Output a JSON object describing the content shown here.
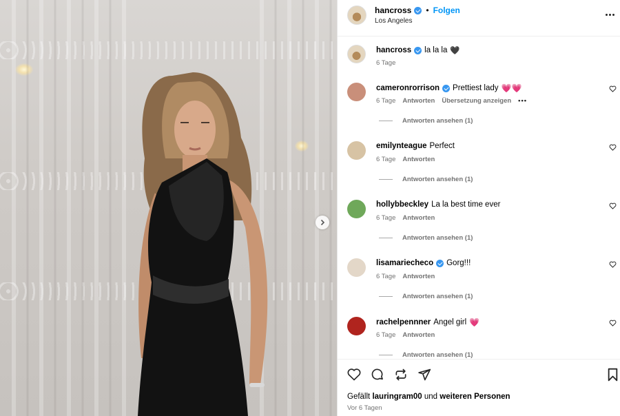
{
  "post": {
    "username": "hancross",
    "follow_label": "Folgen",
    "location": "Los Angeles",
    "caption_text": "la la la",
    "caption_emoji": "🖤",
    "caption_time": "6 Tage"
  },
  "comments": [
    {
      "username": "cameronrorrison",
      "verified": true,
      "text": "Prettiest lady",
      "emoji": "💗💗",
      "time": "6 Tage",
      "reply_label": "Antworten",
      "translate_label": "Übersetzung anzeigen",
      "view_replies": "Antworten ansehen (1)",
      "avatar_color": "#c98f7a"
    },
    {
      "username": "emilynteague",
      "verified": false,
      "text": "Perfect",
      "emoji": "",
      "time": "6 Tage",
      "reply_label": "Antworten",
      "view_replies": "Antworten ansehen (1)",
      "avatar_color": "#d7c3a4"
    },
    {
      "username": "hollybbeckley",
      "verified": false,
      "text": "La la best time ever",
      "emoji": "",
      "time": "6 Tage",
      "reply_label": "Antworten",
      "view_replies": "Antworten ansehen (1)",
      "avatar_color": "#6fa85a"
    },
    {
      "username": "lisamariecheco",
      "verified": true,
      "text": "Gorg!!!",
      "emoji": "",
      "time": "6 Tage",
      "reply_label": "Antworten",
      "view_replies": "Antworten ansehen (1)",
      "avatar_color": "#e3d7c8"
    },
    {
      "username": "rachelpennner",
      "verified": false,
      "text": "Angel girl",
      "emoji": "💗",
      "time": "6 Tage",
      "reply_label": "Antworten",
      "view_replies": "Antworten ansehen (1)",
      "avatar_color": "#b0241e"
    }
  ],
  "footer": {
    "likes_prefix": "Gefällt",
    "likes_user": "lauringram00",
    "likes_mid": "und",
    "likes_suffix": "weiteren Personen",
    "age": "Vor 6 Tagen"
  },
  "icons": [
    "heart-icon",
    "comment-icon",
    "share-icon",
    "send-icon",
    "bookmark-icon",
    "more-icon",
    "verified-icon",
    "chevron-right-icon"
  ],
  "colors": {
    "accent": "#0095f6",
    "verified": "#3897f0",
    "meta": "#737373",
    "like_heart": "#ee3e72"
  }
}
